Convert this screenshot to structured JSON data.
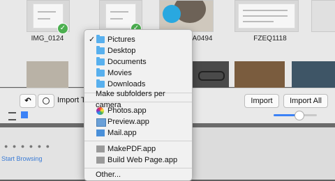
{
  "thumbnails": {
    "labels": [
      "IMG_0124",
      "A0494",
      "FZEQ1118"
    ]
  },
  "toolbar": {
    "import_to_label": "Import To",
    "import_button": "Import",
    "import_all_button": "Import All"
  },
  "menu": {
    "folders": [
      {
        "label": "Pictures",
        "checked": true
      },
      {
        "label": "Desktop",
        "checked": false
      },
      {
        "label": "Documents",
        "checked": false
      },
      {
        "label": "Movies",
        "checked": false
      },
      {
        "label": "Downloads",
        "checked": false
      }
    ],
    "subfolders_label": "Make subfolders per camera",
    "apps": [
      "Photos.app",
      "Preview.app",
      "Mail.app"
    ],
    "automator": [
      "MakePDF.app",
      "Build Web Page.app"
    ],
    "other_label": "Other..."
  },
  "lower": {
    "link_text": "Start Browsing"
  },
  "icons": {
    "rotate": "rotate-icon",
    "delete": "delete-icon",
    "list_view": "list-view-icon",
    "grid_view": "grid-view-icon"
  },
  "colors": {
    "folder": "#58b0ee",
    "check": "#4caf50",
    "slider": "#3b82f6"
  },
  "zoom_slider": {
    "value": 0.55
  }
}
